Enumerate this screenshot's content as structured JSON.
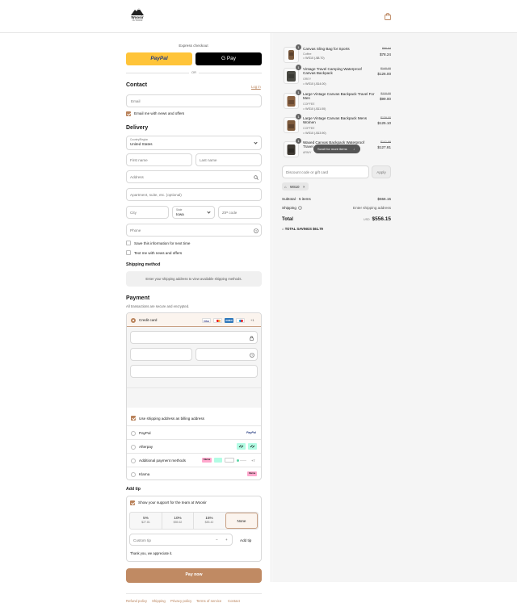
{
  "header": {
    "logo_text": "Woosir",
    "logo_sub": "OUTDOOR",
    "bag_icon": "shopping-bag-icon"
  },
  "express": {
    "label": "Express checkout",
    "paypal_label": "PayPal",
    "gpay_label": "G Pay",
    "or_label": "OR"
  },
  "contact": {
    "title": "Contact",
    "login_label": "Log in",
    "email_placeholder": "Email",
    "news_label": "Email me with news and offers"
  },
  "delivery": {
    "title": "Delivery",
    "country_label": "Country/Region",
    "country_value": "United States",
    "first_name": "First name",
    "last_name": "Last name",
    "address": "Address",
    "apartment": "Apartment, suite, etc. (optional)",
    "city": "City",
    "state_label": "State",
    "state_value": "Iowa",
    "zip": "ZIP code",
    "phone": "Phone",
    "save_label": "Save this information for next time",
    "text_label": "Text me with news and offers"
  },
  "shipping": {
    "title": "Shipping method",
    "note": "Enter your shipping address to view available shipping methods."
  },
  "payment": {
    "title": "Payment",
    "subtitle": "All transactions are secure and encrypted.",
    "credit_label": "Credit card",
    "more_cards": "+1",
    "billing_label": "Use shipping address as billing address",
    "paypal_label": "PayPal",
    "afterpay_label": "Afterpay",
    "additional_label": "Additional payment methods",
    "additional_more": "+7",
    "klarna_label": "Klarna",
    "card_brands": [
      "VISA",
      "MC",
      "AMEX",
      "MAESTRO"
    ]
  },
  "tip": {
    "title": "Add tip",
    "support_label": "Show your support for the team at Woosir",
    "options": [
      {
        "pct": "5%",
        "amt": "$27.81"
      },
      {
        "pct": "10%",
        "amt": "$55.62"
      },
      {
        "pct": "15%",
        "amt": "$83.42"
      },
      {
        "pct": "None",
        "amt": ""
      }
    ],
    "custom_placeholder": "Custom tip",
    "add_label": "Add tip",
    "thanks": "Thank you, we appreciate it."
  },
  "pay_button": "Pay now",
  "footer": {
    "links": [
      "Refund policy",
      "Shipping",
      "Privacy policy",
      "Terms of service",
      "Contact"
    ]
  },
  "summary": {
    "items": [
      {
        "qty": "1",
        "name": "Canvas Sling Bag for Sports",
        "variant": "Coffee",
        "discount": "WS10 (-$8.70)",
        "old": "$86.94",
        "price": "$78.24"
      },
      {
        "qty": "1",
        "name": "Vintage Travel Camping Waterproof Canvas Backpack",
        "variant": "GREY",
        "discount": "WS10 (-$14.00)",
        "old": "$140.00",
        "price": "$126.00"
      },
      {
        "qty": "1",
        "name": "Large Vintage Canvas Backpack Travel For Men",
        "variant": "COFFEE",
        "discount": "WS10 (-$11.00)",
        "old": "$110.00",
        "price": "$99.00"
      },
      {
        "qty": "1",
        "name": "Large Vintage Canvas Backpack Mens Women",
        "variant": "COFFEE",
        "discount": "WS10 (-$13.90)",
        "old": "$139.00",
        "price": "$125.10"
      },
      {
        "qty": "1",
        "name": "Waxed Canvas Backpack Waterproof Travel",
        "variant": "ARMY",
        "discount": "WS10 (-$14.19)",
        "old": "$141.99",
        "price": "$127.81"
      }
    ],
    "scroll_hint": "Scroll for more items",
    "discount_placeholder": "Discount code or gift card",
    "apply_label": "Apply",
    "code_tag": "WS10",
    "subtotal_label": "Subtotal · 5 items",
    "subtotal_value": "$556.15",
    "shipping_label": "Shipping",
    "shipping_value": "Enter shipping address",
    "total_label": "Total",
    "currency": "USD",
    "total_value": "$556.15",
    "savings_label": "TOTAL SAVINGS",
    "savings_value": "$61.79"
  },
  "colors": {
    "accent": "#b9825a",
    "paypal": "#ffc439",
    "gpay": "#000000",
    "pay_button": "#c08a63"
  }
}
